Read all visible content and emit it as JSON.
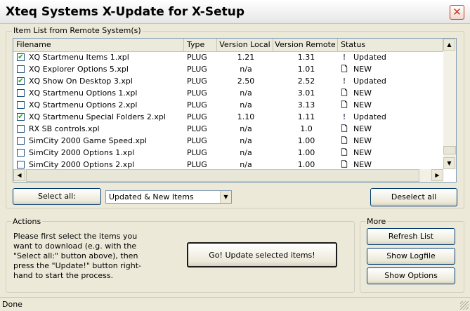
{
  "window": {
    "title": "Xteq Systems X-Update for X-Setup",
    "close_glyph": "✕"
  },
  "item_list": {
    "legend": "Item List from Remote System(s)",
    "columns": [
      "Filename",
      "Type",
      "Version Local",
      "Version Remote",
      "Status"
    ],
    "rows": [
      {
        "checked": true,
        "filename": "XQ Startmenu Items 1.xpl",
        "type": "PLUG",
        "local": "1.21",
        "remote": "1.31",
        "status_icon": "!",
        "status": "Updated"
      },
      {
        "checked": false,
        "filename": "XQ Explorer Options 5.xpl",
        "type": "PLUG",
        "local": "n/a",
        "remote": "1.01",
        "status_icon": "🗋",
        "status": "NEW"
      },
      {
        "checked": true,
        "filename": "XQ Show On Desktop 3.xpl",
        "type": "PLUG",
        "local": "2.50",
        "remote": "2.52",
        "status_icon": "!",
        "status": "Updated"
      },
      {
        "checked": false,
        "filename": "XQ Startmenu Options 1.xpl",
        "type": "PLUG",
        "local": "n/a",
        "remote": "3.01",
        "status_icon": "🗋",
        "status": "NEW"
      },
      {
        "checked": false,
        "filename": "XQ Startmenu Options 2.xpl",
        "type": "PLUG",
        "local": "n/a",
        "remote": "3.13",
        "status_icon": "🗋",
        "status": "NEW"
      },
      {
        "checked": true,
        "filename": "XQ Startmenu Special Folders 2.xpl",
        "type": "PLUG",
        "local": "1.10",
        "remote": "1.11",
        "status_icon": "!",
        "status": "Updated"
      },
      {
        "checked": false,
        "filename": "RX SB controls.xpl",
        "type": "PLUG",
        "local": "n/a",
        "remote": "1.0",
        "status_icon": "🗋",
        "status": "NEW"
      },
      {
        "checked": false,
        "filename": "SimCity 2000 Game Speed.xpl",
        "type": "PLUG",
        "local": "n/a",
        "remote": "1.00",
        "status_icon": "🗋",
        "status": "NEW"
      },
      {
        "checked": false,
        "filename": "SimCity 2000 Options 1.xpl",
        "type": "PLUG",
        "local": "n/a",
        "remote": "1.00",
        "status_icon": "🗋",
        "status": "NEW"
      },
      {
        "checked": false,
        "filename": "SimCity 2000 Options 2.xpl",
        "type": "PLUG",
        "local": "n/a",
        "remote": "1.00",
        "status_icon": "🗋",
        "status": "NEW"
      }
    ]
  },
  "controls": {
    "select_all": "Select all:",
    "filter_selected": "Updated & New Items",
    "deselect_all": "Deselect all"
  },
  "actions": {
    "legend": "Actions",
    "description": "Please first select the items you want to download (e.g. with the \"Select all:\" button above), then press the \"Update!\" button right-hand to start the process.",
    "go_button": "Go! Update selected items!"
  },
  "more": {
    "legend": "More",
    "refresh": "Refresh List",
    "show_logfile": "Show Logfile",
    "show_options": "Show Options"
  },
  "status": {
    "text": "Done"
  },
  "colors": {
    "checkmark": "#21a121",
    "accent": "#003c74",
    "updated_icon": "#7a7a8c"
  }
}
